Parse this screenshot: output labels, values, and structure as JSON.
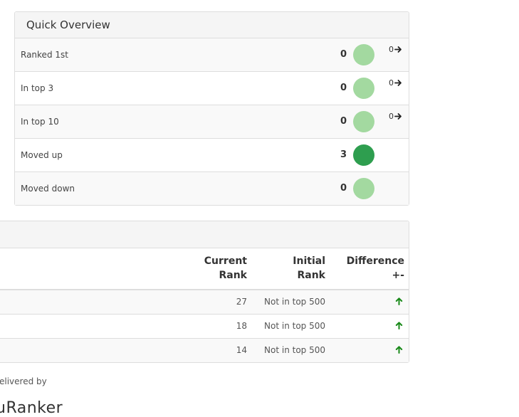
{
  "quick_overview": {
    "title": "Quick Overview",
    "rows": [
      {
        "label": "Ranked 1st",
        "count": "0",
        "dot_color": "#a3d9a0",
        "change": "0"
      },
      {
        "label": "In top 3",
        "count": "0",
        "dot_color": "#a3d9a0",
        "change": "0"
      },
      {
        "label": "In top 10",
        "count": "0",
        "dot_color": "#a3d9a0",
        "change": "0"
      },
      {
        "label": "Moved up",
        "count": "3",
        "dot_color": "#2e9e4f"
      },
      {
        "label": "Moved down",
        "count": "0",
        "dot_color": "#a3d9a0"
      }
    ]
  },
  "rank_table": {
    "headers": {
      "current_rank_line1": "Current",
      "current_rank_line2": "Rank",
      "initial_rank_line1": "Initial",
      "initial_rank_line2": "Rank",
      "difference_line1": "Difference",
      "difference_line2": "+-"
    },
    "rows": [
      {
        "current": "27",
        "initial": "Not in top 500",
        "difference_icon": "arrow-up-icon"
      },
      {
        "current": "18",
        "initial": "Not in top 500",
        "difference_icon": "arrow-up-icon"
      },
      {
        "current": "14",
        "initial": "Not in top 500",
        "difference_icon": "arrow-up-icon"
      }
    ],
    "up_arrow_color": "#1a8a1a"
  },
  "footer": {
    "delivered_by": "elivered by",
    "logo_text": "uRanker"
  }
}
